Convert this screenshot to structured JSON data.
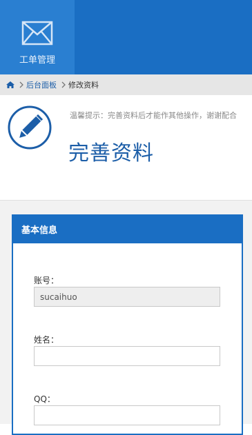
{
  "nav": {
    "items": [
      {
        "label": "工单管理",
        "icon": "envelope-icon"
      }
    ]
  },
  "breadcrumb": {
    "home_icon": "home-icon",
    "items": [
      "后台面板",
      "修改资料"
    ]
  },
  "header": {
    "tip": "温馨提示：完善资料后才能作其他操作，谢谢配合",
    "title": "完善资料",
    "icon": "pencil-icon"
  },
  "panel": {
    "title": "基本信息",
    "fields": [
      {
        "label": "账号：",
        "value": "sucaihuo",
        "disabled": true
      },
      {
        "label": "姓名：",
        "value": ""
      },
      {
        "label": "QQ：",
        "value": ""
      }
    ]
  },
  "colors": {
    "primary": "#1a6ec3",
    "nav_active": "#2a7fd1",
    "title": "#1c5ea8"
  }
}
